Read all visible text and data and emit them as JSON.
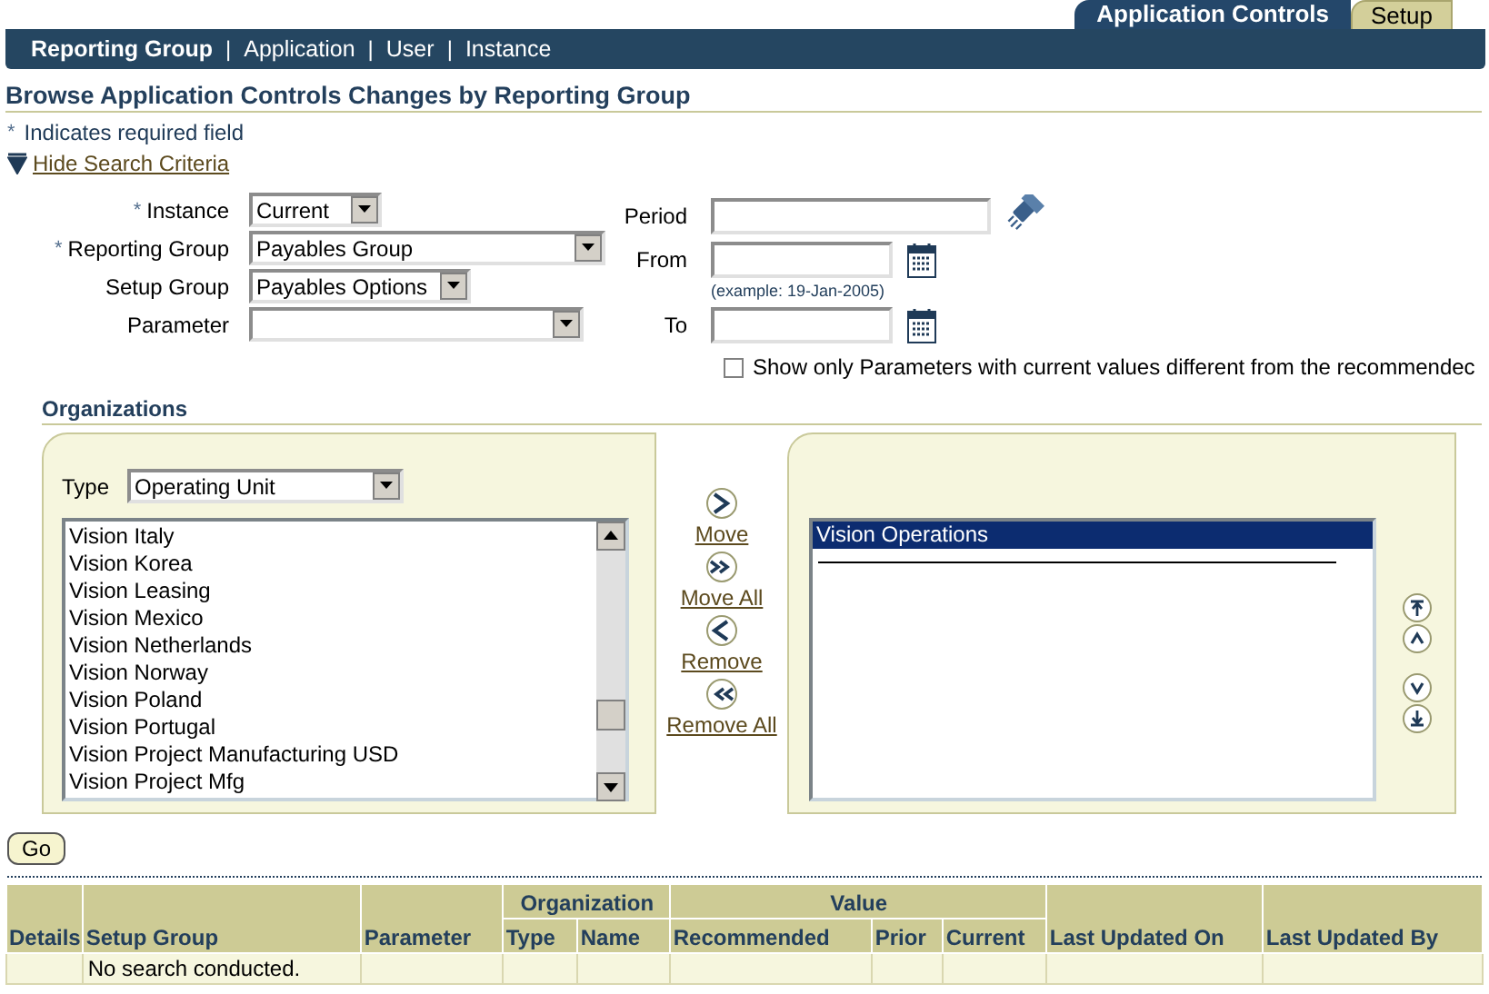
{
  "tabs": [
    {
      "label": "Application Controls",
      "selected": true
    },
    {
      "label": "Setup",
      "selected": false
    }
  ],
  "subtabs": [
    {
      "label": "Reporting Group",
      "selected": true
    },
    {
      "label": "Application",
      "selected": false
    },
    {
      "label": "User",
      "selected": false
    },
    {
      "label": "Instance",
      "selected": false
    }
  ],
  "subtab_separators": [
    "|",
    "|",
    "|"
  ],
  "page_title": "Browse Application Controls Changes by Reporting Group",
  "required_note": {
    "mark": "*",
    "text": "Indicates required field"
  },
  "hide_search_link": "Hide Search Criteria",
  "search_fields_left": [
    {
      "label": "Instance",
      "required": true,
      "required_mark": "*",
      "value": "Current"
    },
    {
      "label": "Reporting Group",
      "required": true,
      "required_mark": "*",
      "value": "Payables Group"
    },
    {
      "label": "Setup Group",
      "required": false,
      "value": "Payables Options"
    },
    {
      "label": "Parameter",
      "required": false
    }
  ],
  "search_fields_right": [
    {
      "label": "Period",
      "kind": "lookup"
    },
    {
      "label": "From",
      "kind": "date",
      "hint": "(example: 19-Jan-2005)"
    },
    {
      "label": "To",
      "kind": "date"
    }
  ],
  "only_different_checkbox": {
    "label": "Show only Parameters with current values different from the recommendec",
    "checked": false
  },
  "organizations": {
    "heading": "Organizations",
    "type_label": "Type",
    "type_value": "Operating Unit",
    "available": [
      {
        "label": "Vision Italy",
        "selected": false
      },
      {
        "label": "Vision Korea",
        "selected": false
      },
      {
        "label": "Vision Leasing",
        "selected": false
      },
      {
        "label": "Vision Mexico",
        "selected": false
      },
      {
        "label": "Vision Netherlands",
        "selected": false
      },
      {
        "label": "Vision Norway",
        "selected": false
      },
      {
        "label": "Vision Poland",
        "selected": false
      },
      {
        "label": "Vision Portugal",
        "selected": false
      },
      {
        "label": "Vision Project Manufacturing USD",
        "selected": false
      },
      {
        "label": "Vision Project Mfg",
        "selected": false
      }
    ],
    "actions": [
      {
        "label": "Move",
        "kind": "move"
      },
      {
        "label": "Move All",
        "kind": "move_all"
      },
      {
        "label": "Remove",
        "kind": "remove"
      },
      {
        "label": "Remove All",
        "kind": "remove_all"
      }
    ],
    "selected_items": [
      {
        "label": "Vision Operations",
        "selected": true
      }
    ]
  },
  "go_button": "Go",
  "table": {
    "columns": [
      {
        "label": "Details"
      },
      {
        "label": "Setup Group"
      },
      {
        "label": "Parameter"
      },
      {
        "group": "Organization",
        "children": [
          "Type",
          "Name"
        ]
      },
      {
        "group": "Value",
        "children": [
          "Recommended",
          "Prior",
          "Current"
        ]
      },
      {
        "label": "Last Updated On"
      },
      {
        "label": "Last Updated By"
      }
    ],
    "empty_message": "No search conducted."
  }
}
